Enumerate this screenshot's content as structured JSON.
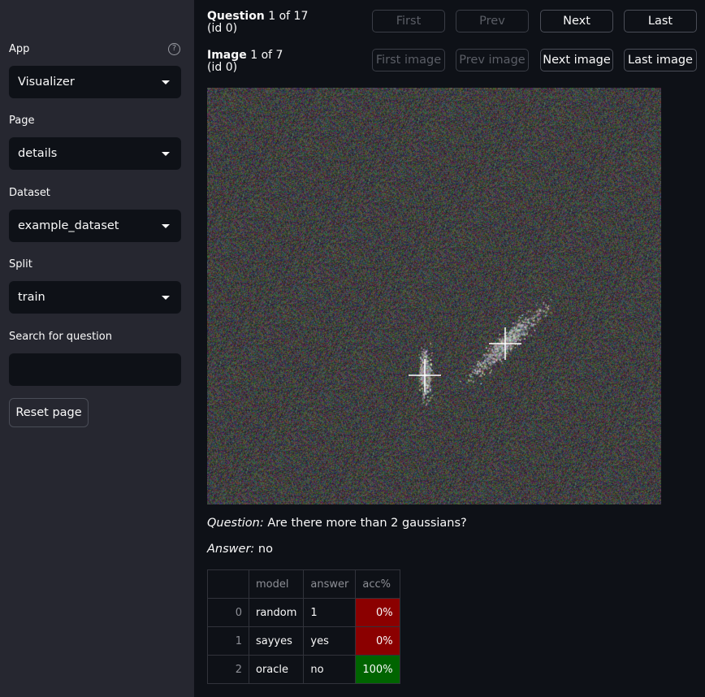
{
  "sidebar": {
    "app": {
      "label": "App",
      "value": "Visualizer"
    },
    "page": {
      "label": "Page",
      "value": "details"
    },
    "dataset": {
      "label": "Dataset",
      "value": "example_dataset"
    },
    "split": {
      "label": "Split",
      "value": "train"
    },
    "search": {
      "label": "Search for question",
      "value": ""
    },
    "reset_label": "Reset page",
    "help_glyph": "?"
  },
  "question_nav": {
    "title_bold": "Question",
    "counter": " 1 of 17",
    "id": "(id 0)",
    "buttons": [
      "First",
      "Prev",
      "Next",
      "Last"
    ]
  },
  "image_nav": {
    "title_bold": "Image",
    "counter": " 1 of 7",
    "id": "(id 0)",
    "buttons": [
      "First image",
      "Prev image",
      "Next image",
      "Last image"
    ]
  },
  "question": {
    "label": "Question:",
    "text": " Are there more than 2 gaussians?"
  },
  "answer": {
    "label": "Answer:",
    "text": " no"
  },
  "results_table": {
    "columns": [
      "",
      "model",
      "answer",
      "acc%"
    ],
    "rows": [
      {
        "index": "0",
        "model": "random",
        "answer": "1",
        "acc": "0%",
        "color": "#8b0000"
      },
      {
        "index": "1",
        "model": "sayyes",
        "answer": "yes",
        "acc": "0%",
        "color": "#8b0000"
      },
      {
        "index": "2",
        "model": "oracle",
        "answer": "no",
        "acc": "100%",
        "color": "#006400"
      }
    ]
  },
  "colors": {
    "bad": "#8b0000",
    "good": "#006400",
    "accent": "#ffffff"
  }
}
